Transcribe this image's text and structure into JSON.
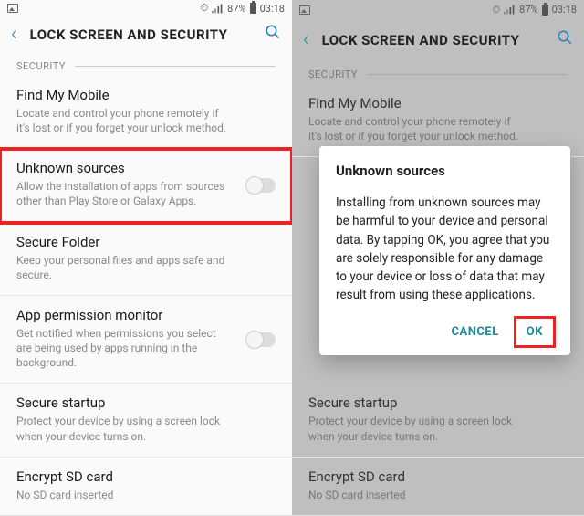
{
  "status": {
    "battery_pct": "87%",
    "time": "03:18"
  },
  "header": {
    "title": "LOCK SCREEN AND SECURITY"
  },
  "section": "SECURITY",
  "items": {
    "find": {
      "title": "Find My Mobile",
      "desc": "Locate and control your phone remotely if it's lost or if you forget your unlock method."
    },
    "unknown": {
      "title": "Unknown sources",
      "desc": "Allow the installation of apps from sources other than Play Store or Galaxy Apps."
    },
    "secure_folder": {
      "title": "Secure Folder",
      "desc": "Keep your personal files and apps safe and secure."
    },
    "perm_monitor": {
      "title": "App permission monitor",
      "desc": "Get notified when permissions you select are being used by apps running in the background."
    },
    "secure_startup": {
      "title": "Secure startup",
      "desc": "Protect your device by using a screen lock when your device turns on."
    },
    "encrypt_sd": {
      "title": "Encrypt SD card",
      "desc": "No SD card inserted"
    }
  },
  "dialog": {
    "title": "Unknown sources",
    "body": "Installing from unknown sources may be harmful to your device and personal data. By tapping OK, you agree that you are solely responsible for any damage to your device or loss of data that may result from using these applications.",
    "cancel": "CANCEL",
    "ok": "OK"
  }
}
